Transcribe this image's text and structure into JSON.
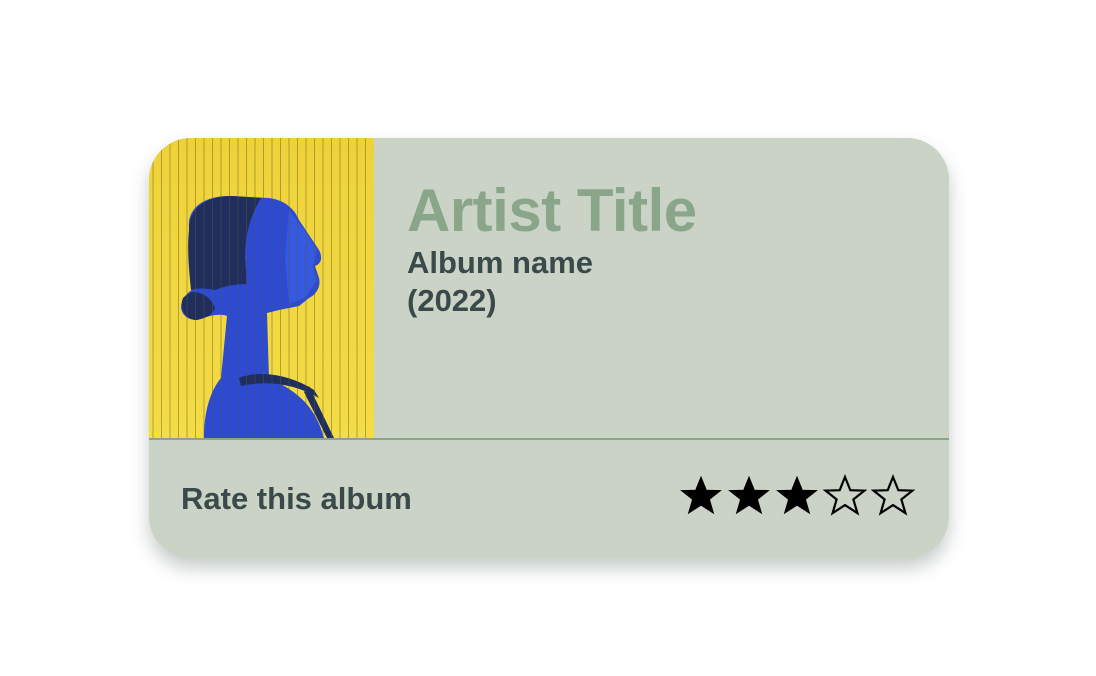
{
  "card": {
    "artist_title": "Artist Title",
    "album_name": "Album name",
    "year": "(2022)",
    "rate_label": "Rate this album",
    "rating": 3,
    "max_rating": 5
  },
  "colors": {
    "card_bg": "#cbd3c7",
    "artist_title": "#8aa68a",
    "text_dark": "#3a4a4a",
    "divider": "#8aa68a",
    "star": "#000000",
    "cover_yellow": "#f2d53c",
    "cover_blue": "#2a4fd0"
  },
  "icons": {
    "filled_star": "filled-star-icon",
    "empty_star": "empty-star-icon"
  }
}
